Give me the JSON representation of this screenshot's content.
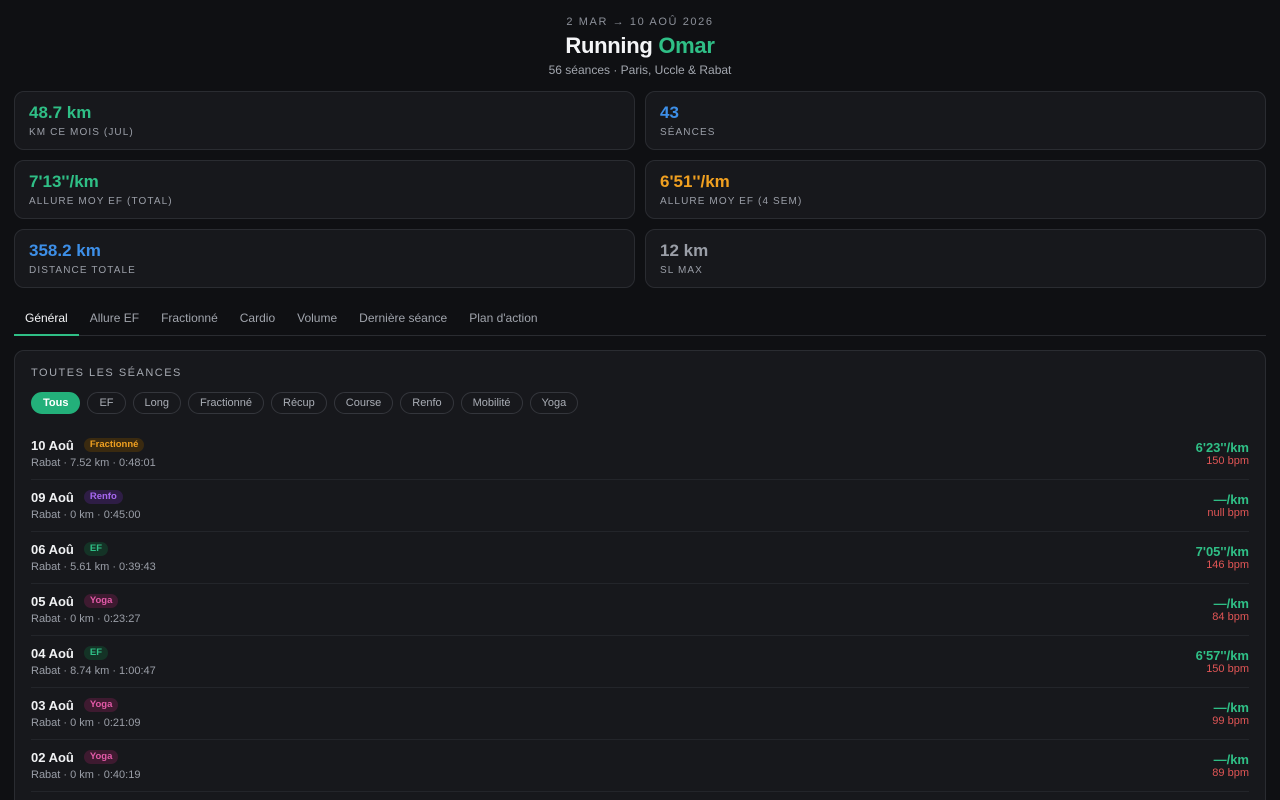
{
  "header": {
    "date_range": "2 MAR → 10 AOÛ 2026",
    "title_main": "Running",
    "title_accent": "Omar",
    "subtitle": "56 séances · Paris, Uccle & Rabat"
  },
  "stats": [
    {
      "value": "48.7 km",
      "label": "KM CE MOIS (JUL)",
      "color": "#2fbf86"
    },
    {
      "value": "43",
      "label": "SÉANCES",
      "color": "#3d8fe8"
    },
    {
      "value": "7'13''/km",
      "label": "ALLURE MOY EF (TOTAL)",
      "color": "#2fbf86"
    },
    {
      "value": "6'51''/km",
      "label": "ALLURE MOY EF (4 SEM)",
      "color": "#f0a020"
    },
    {
      "value": "358.2 km",
      "label": "DISTANCE TOTALE",
      "color": "#3d8fe8"
    },
    {
      "value": "12 km",
      "label": "SL MAX",
      "color": "#9a9ea7"
    }
  ],
  "tabs": [
    {
      "label": "Général",
      "active": true
    },
    {
      "label": "Allure EF"
    },
    {
      "label": "Fractionné"
    },
    {
      "label": "Cardio"
    },
    {
      "label": "Volume"
    },
    {
      "label": "Dernière séance"
    },
    {
      "label": "Plan d'action"
    }
  ],
  "panel": {
    "title": "TOUTES LES SÉANCES",
    "filters": [
      {
        "label": "Tous",
        "active": true
      },
      {
        "label": "EF"
      },
      {
        "label": "Long"
      },
      {
        "label": "Fractionné"
      },
      {
        "label": "Récup"
      },
      {
        "label": "Course"
      },
      {
        "label": "Renfo"
      },
      {
        "label": "Mobilité"
      },
      {
        "label": "Yoga"
      }
    ],
    "sessions": [
      {
        "date": "10 Aoû",
        "type": "Fractionné",
        "meta": "Rabat · 7.52 km · 0:48:01",
        "pace": "6'23''/km",
        "bpm": "150 bpm"
      },
      {
        "date": "09 Aoû",
        "type": "Renfo",
        "meta": "Rabat · 0 km · 0:45:00",
        "pace": "—/km",
        "bpm": "null bpm"
      },
      {
        "date": "06 Aoû",
        "type": "EF",
        "meta": "Rabat · 5.61 km · 0:39:43",
        "pace": "7'05''/km",
        "bpm": "146 bpm"
      },
      {
        "date": "05 Aoû",
        "type": "Yoga",
        "meta": "Rabat · 0 km · 0:23:27",
        "pace": "—/km",
        "bpm": "84 bpm"
      },
      {
        "date": "04 Aoû",
        "type": "EF",
        "meta": "Rabat · 8.74 km · 1:00:47",
        "pace": "6'57''/km",
        "bpm": "150 bpm"
      },
      {
        "date": "03 Aoû",
        "type": "Yoga",
        "meta": "Rabat · 0 km · 0:21:09",
        "pace": "—/km",
        "bpm": "99 bpm"
      },
      {
        "date": "02 Aoû",
        "type": "Yoga",
        "meta": "Rabat · 0 km · 0:40:19",
        "pace": "—/km",
        "bpm": "89 bpm"
      }
    ]
  },
  "badge_colors": {
    "Fractionné": {
      "bg": "#3a2a10",
      "fg": "#f0a020"
    },
    "Renfo": {
      "bg": "#2e1d45",
      "fg": "#a668f0"
    },
    "EF": {
      "bg": "#143326",
      "fg": "#2fbf86"
    },
    "Yoga": {
      "bg": "#3e1a30",
      "fg": "#e35aa8"
    }
  }
}
